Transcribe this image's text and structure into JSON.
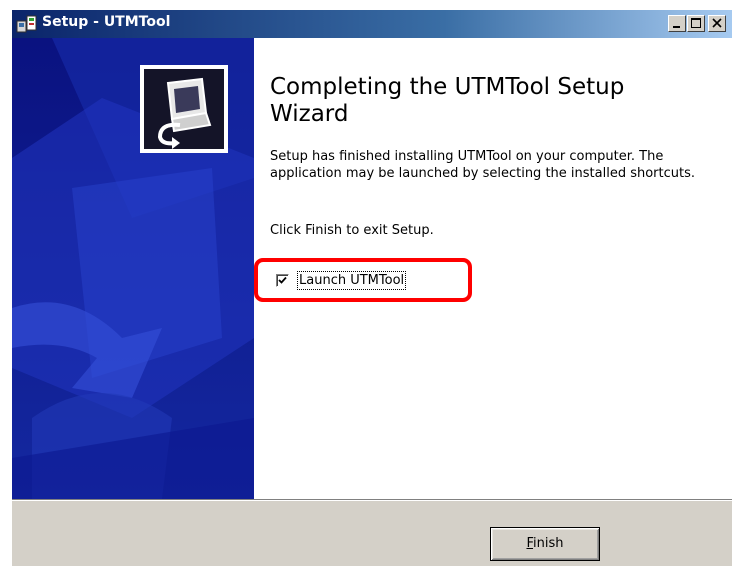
{
  "window": {
    "title": "Setup - UTMTool",
    "icon": "setup-installer-icon"
  },
  "title_buttons": {
    "minimize_icon": "minimize-icon",
    "maximize_icon": "maximize-icon",
    "close_icon": "close-icon"
  },
  "wizard": {
    "heading": "Completing the UTMTool Setup Wizard",
    "body": "Setup has finished installing UTMTool on your computer. The application may be launched by selecting the installed shortcuts.",
    "exit_instruction": "Click Finish to exit Setup.",
    "launch_checkbox": {
      "label": "Launch UTMTool",
      "checked": true
    },
    "logo_icon": "computer-install-icon"
  },
  "footer": {
    "finish_button": {
      "accel": "F",
      "rest": "inish"
    }
  },
  "colors": {
    "banner": "#0d1a8a",
    "highlight": "#ff0000",
    "dialog_face": "#d4d0c8"
  }
}
